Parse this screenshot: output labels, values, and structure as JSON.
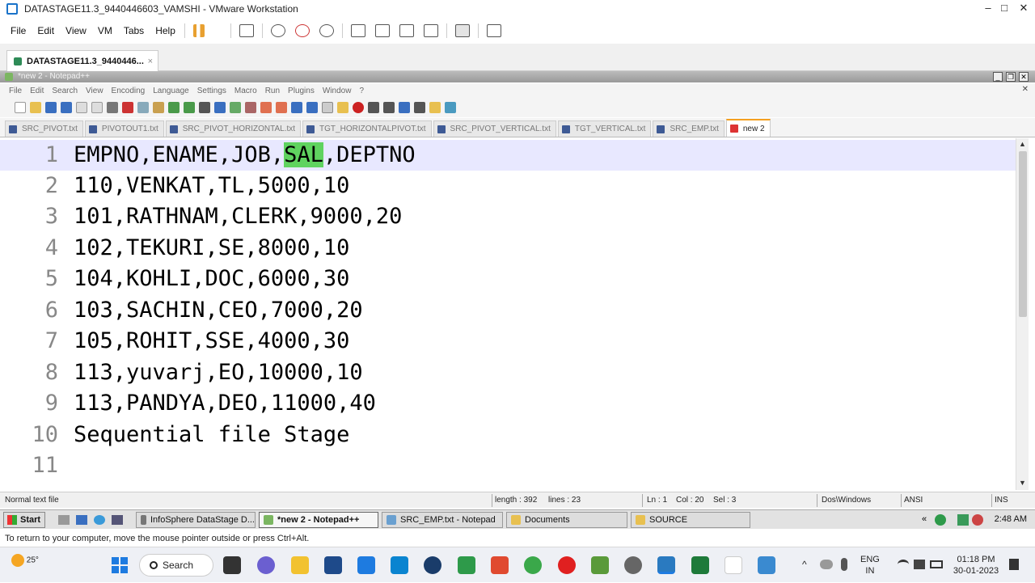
{
  "vm_window": {
    "title": "DATASTAGE11.3_9440446603_VAMSHI - VMware Workstation",
    "minimize": "–",
    "maximize": "□",
    "close": "✕",
    "menu": [
      "File",
      "Edit",
      "View",
      "VM",
      "Tabs",
      "Help"
    ],
    "tab_label": "DATASTAGE11.3_9440446...",
    "tab_close": "×",
    "hint": "To return to your computer, move the mouse pointer outside or press Ctrl+Alt."
  },
  "notepad": {
    "title": "*new  2 - Notepad++",
    "ctl_minimize": "_",
    "ctl_restore": "❐",
    "ctl_close": "✕",
    "doc_close": "✕",
    "menu": [
      "File",
      "Edit",
      "Search",
      "View",
      "Encoding",
      "Language",
      "Settings",
      "Macro",
      "Run",
      "Plugins",
      "Window",
      "?"
    ],
    "tabs": [
      "SRC_PIVOT.txt",
      "PIVOTOUT1.txt",
      "SRC_PIVOT_HORIZONTAL.txt",
      "TGT_HORIZONTALPIVOT.txt",
      "SRC_PIVOT_VERTICAL.txt",
      "TGT_VERTICAL.txt",
      "SRC_EMP.txt",
      "new  2"
    ],
    "lines": [
      {
        "num": "1",
        "pre": "EMPNO,ENAME,JOB,",
        "hl": "SAL",
        "post": ",DEPTNO"
      },
      {
        "num": "2",
        "pre": "110,VENKAT,TL,5000,10",
        "hl": "",
        "post": ""
      },
      {
        "num": "3",
        "pre": "101,RATHNAM,CLERK,9000,20",
        "hl": "",
        "post": ""
      },
      {
        "num": "4",
        "pre": "102,TEKURI,SE,8000,10",
        "hl": "",
        "post": ""
      },
      {
        "num": "5",
        "pre": "104,KOHLI,DOC,6000,30",
        "hl": "",
        "post": ""
      },
      {
        "num": "6",
        "pre": "103,SACHIN,CEO,7000,20",
        "hl": "",
        "post": ""
      },
      {
        "num": "7",
        "pre": "105,ROHIT,SSE,4000,30",
        "hl": "",
        "post": ""
      },
      {
        "num": "8",
        "pre": "113,yuvarj,EO,10000,10",
        "hl": "",
        "post": ""
      },
      {
        "num": "9",
        "pre": "113,PANDYA,DEO,11000,40",
        "hl": "",
        "post": ""
      },
      {
        "num": "10",
        "pre": "Sequential file Stage",
        "hl": "",
        "post": ""
      },
      {
        "num": "11",
        "pre": "",
        "hl": "",
        "post": ""
      }
    ],
    "status": {
      "file_type": "Normal text file",
      "length": "length : 392",
      "lines": "lines : 23",
      "ln": "Ln : 1",
      "col": "Col : 20",
      "sel": "Sel : 3",
      "eol": "Dos\\Windows",
      "encoding": "ANSI",
      "mode": "INS"
    }
  },
  "guest_taskbar": {
    "start": "Start",
    "tasks": [
      "InfoSphere DataStage D...",
      "*new  2 - Notepad++",
      "SRC_EMP.txt - Notepad",
      "Documents",
      "SOURCE"
    ],
    "clock": "2:48 AM"
  },
  "host_taskbar": {
    "weather": "25°",
    "search": "Search",
    "lang_line1": "ENG",
    "lang_line2": "IN",
    "time": "01:18 PM",
    "date": "30-01-2023"
  }
}
